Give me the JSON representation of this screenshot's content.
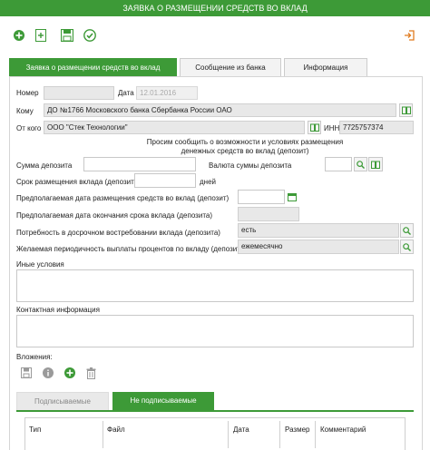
{
  "window": {
    "title": "ЗАЯВКА О РАЗМЕЩЕНИИ СРЕДСТВ ВО ВКЛАД"
  },
  "toolbar": {
    "add_icon": "plus-circle-icon",
    "new_doc_icon": "new-document-icon",
    "save_icon": "save-icon",
    "sign_icon": "check-circle-icon",
    "exit_icon": "exit-icon"
  },
  "tabs": [
    {
      "label": "Заявка о размещении средств во вклад"
    },
    {
      "label": "Сообщение из банка"
    },
    {
      "label": "Информация"
    }
  ],
  "form": {
    "number_label": "Номер",
    "number_value": "",
    "date_label": "Дата",
    "date_value": "12.01.2016",
    "to_label": "Кому",
    "to_value": "ДО №1766 Московского банка Сбербанка России ОАО",
    "from_label": "От кого",
    "from_value": "ООО \"Стек Технологии\"",
    "inn_label": "ИНН",
    "inn_value": "7725757374",
    "request_text": "Просим сообщить о возможности и условиях размещения денежных средств во вклад (депозит)",
    "deposit_sum_label": "Сумма депозита",
    "deposit_sum_value": "",
    "currency_label": "Валюта суммы депозита",
    "currency_value": "",
    "term_label": "Срок размещения вклада (депозита)",
    "term_value": "",
    "term_unit": "дней",
    "planned_start_label": "Предполагаемая дата размещения средств во вклад (депозит)",
    "planned_start_value": "",
    "planned_end_label": "Предполагаемая дата окончания срока вклада (депозита)",
    "planned_end_value": "",
    "early_withdraw_label": "Потребность в досрочном востребовании вклада (депозита)",
    "early_withdraw_value": "есть",
    "payout_label": "Желаемая периодичность выплаты процентов по вкладу (депозиту)",
    "payout_value": "ежемесячно",
    "other_conditions_label": "Иные условия",
    "contact_label": "Контактная информация",
    "attachments_label": "Вложения:"
  },
  "attachment_toolbar": {
    "save_icon": "save-icon",
    "info_icon": "info-icon",
    "add_icon": "plus-circle-icon",
    "delete_icon": "trash-icon"
  },
  "subtabs": [
    {
      "label": "Подписываемые"
    },
    {
      "label": "Не подписываемые"
    }
  ],
  "table": {
    "columns": [
      "Тип",
      "Файл",
      "Дата",
      "Размер",
      "Комментарий"
    ]
  },
  "colors": {
    "brand_green": "#3d9a37",
    "field_border": "#c8c8c8"
  }
}
